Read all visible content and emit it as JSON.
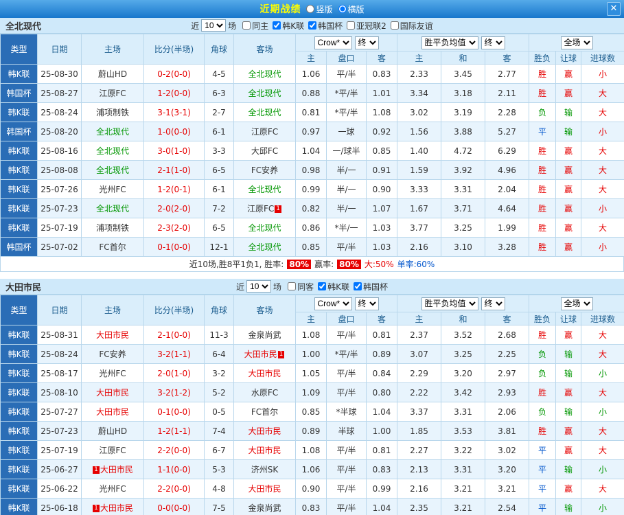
{
  "titlebar": {
    "title": "近期战绩",
    "layout_vertical": "竖版",
    "layout_horizontal": "横版",
    "close": "✕"
  },
  "table_header": {
    "type": "类型",
    "date": "日期",
    "home": "主场",
    "score": "比分(半场)",
    "corner": "角球",
    "away": "客场",
    "company": "Crow*",
    "final": "终",
    "europe": "胜平负均值",
    "fullmatch": "全场",
    "sub_asian_home": "主",
    "sub_handicap": "盘口",
    "sub_asian_away": "客",
    "sub_eu_home": "主",
    "sub_eu_draw": "和",
    "sub_eu_away": "客",
    "sub_wdl": "胜负",
    "sub_handicap_result": "让球",
    "sub_goals": "进球数"
  },
  "sections": [
    {
      "team": "全北现代",
      "filter": {
        "near": "近",
        "count": "10",
        "games": "场",
        "checkboxes": [
          {
            "label": "同主",
            "checked": false
          },
          {
            "label": "韩K联",
            "checked": true
          },
          {
            "label": "韩国杯",
            "checked": true
          },
          {
            "label": "亚冠联2",
            "checked": false
          },
          {
            "label": "国际友谊",
            "checked": false
          }
        ]
      },
      "rows": [
        {
          "type": "韩K联",
          "date": "25-08-30",
          "home": "蔚山HD",
          "score": "0-2(0-0)",
          "corner": "4-5",
          "away": "全北现代",
          "away_cls": "green",
          "ah": "1.06",
          "hc": "平/半",
          "aa": "0.83",
          "eh": "2.33",
          "ed": "3.45",
          "ea": "2.77",
          "r1": "胜",
          "r1c": "red",
          "r2": "赢",
          "r2c": "red",
          "r3": "小",
          "r3c": "red"
        },
        {
          "type": "韩国杯",
          "date": "25-08-27",
          "home": "江原FC",
          "score": "1-2(0-0)",
          "corner": "6-3",
          "away": "全北现代",
          "away_cls": "green",
          "ah": "0.88",
          "hc": "*平/半",
          "aa": "1.01",
          "eh": "3.34",
          "ed": "3.18",
          "ea": "2.11",
          "r1": "胜",
          "r1c": "red",
          "r2": "赢",
          "r2c": "red",
          "r3": "大",
          "r3c": "red"
        },
        {
          "type": "韩K联",
          "date": "25-08-24",
          "home": "浦项制铁",
          "score": "3-1(3-1)",
          "corner": "2-7",
          "away": "全北现代",
          "away_cls": "green",
          "ah": "0.81",
          "hc": "*平/半",
          "aa": "1.08",
          "eh": "3.02",
          "ed": "3.19",
          "ea": "2.28",
          "r1": "负",
          "r1c": "green",
          "r2": "输",
          "r2c": "green",
          "r3": "大",
          "r3c": "red"
        },
        {
          "type": "韩国杯",
          "date": "25-08-20",
          "home": "全北现代",
          "home_cls": "green",
          "score": "1-0(0-0)",
          "corner": "6-1",
          "away": "江原FC",
          "ah": "0.97",
          "hc": "一球",
          "aa": "0.92",
          "eh": "1.56",
          "ed": "3.88",
          "ea": "5.27",
          "r1": "平",
          "r1c": "blue",
          "r2": "输",
          "r2c": "green",
          "r3": "小",
          "r3c": "red"
        },
        {
          "type": "韩K联",
          "date": "25-08-16",
          "home": "全北现代",
          "home_cls": "green",
          "score": "3-0(1-0)",
          "corner": "3-3",
          "away": "大邱FC",
          "ah": "1.04",
          "hc": "一/球半",
          "aa": "0.85",
          "eh": "1.40",
          "ed": "4.72",
          "ea": "6.29",
          "r1": "胜",
          "r1c": "red",
          "r2": "赢",
          "r2c": "red",
          "r3": "大",
          "r3c": "red"
        },
        {
          "type": "韩K联",
          "date": "25-08-08",
          "home": "全北现代",
          "home_cls": "green",
          "score": "2-1(1-0)",
          "corner": "6-5",
          "away": "FC安养",
          "ah": "0.98",
          "hc": "半/一",
          "aa": "0.91",
          "eh": "1.59",
          "ed": "3.92",
          "ea": "4.96",
          "r1": "胜",
          "r1c": "red",
          "r2": "赢",
          "r2c": "red",
          "r3": "大",
          "r3c": "red"
        },
        {
          "type": "韩K联",
          "date": "25-07-26",
          "home": "光州FC",
          "score": "1-2(0-1)",
          "corner": "6-1",
          "away": "全北现代",
          "away_cls": "green",
          "ah": "0.99",
          "hc": "半/一",
          "aa": "0.90",
          "eh": "3.33",
          "ed": "3.31",
          "ea": "2.04",
          "r1": "胜",
          "r1c": "red",
          "r2": "赢",
          "r2c": "red",
          "r3": "大",
          "r3c": "red"
        },
        {
          "type": "韩K联",
          "date": "25-07-23",
          "home": "全北现代",
          "home_cls": "green",
          "score": "2-0(2-0)",
          "corner": "7-2",
          "away": "江原FC",
          "away_b_post": "1",
          "ah": "0.82",
          "hc": "半/一",
          "aa": "1.07",
          "eh": "1.67",
          "ed": "3.71",
          "ea": "4.64",
          "r1": "胜",
          "r1c": "red",
          "r2": "赢",
          "r2c": "red",
          "r3": "小",
          "r3c": "red"
        },
        {
          "type": "韩K联",
          "date": "25-07-19",
          "home": "浦项制铁",
          "score": "2-3(2-0)",
          "corner": "6-5",
          "away": "全北现代",
          "away_cls": "green",
          "ah": "0.86",
          "hc": "*半/一",
          "aa": "1.03",
          "eh": "3.77",
          "ed": "3.25",
          "ea": "1.99",
          "r1": "胜",
          "r1c": "red",
          "r2": "赢",
          "r2c": "red",
          "r3": "大",
          "r3c": "red"
        },
        {
          "type": "韩国杯",
          "date": "25-07-02",
          "home": "FC首尔",
          "score": "0-1(0-0)",
          "corner": "12-1",
          "away": "全北现代",
          "away_cls": "green",
          "ah": "0.85",
          "hc": "平/半",
          "aa": "1.03",
          "eh": "2.16",
          "ed": "3.10",
          "ea": "3.28",
          "r1": "胜",
          "r1c": "red",
          "r2": "赢",
          "r2c": "red",
          "r3": "小",
          "r3c": "red"
        }
      ],
      "summary_parts": [
        {
          "text": "近10场,胜8平1负1, 胜率:",
          "cls": ""
        },
        {
          "text": "80%",
          "cls": "badge"
        },
        {
          "text": "赢率:",
          "cls": ""
        },
        {
          "text": "80%",
          "cls": "badge"
        },
        {
          "text": "大:50%",
          "cls": "red"
        },
        {
          "text": "单率:60%",
          "cls": "blue"
        }
      ]
    },
    {
      "team": "大田市民",
      "filter": {
        "near": "近",
        "count": "10",
        "games": "场",
        "checkboxes": [
          {
            "label": "同客",
            "checked": false
          },
          {
            "label": "韩K联",
            "checked": true
          },
          {
            "label": "韩国杯",
            "checked": true
          }
        ]
      },
      "rows": [
        {
          "type": "韩K联",
          "date": "25-08-31",
          "home": "大田市民",
          "home_cls": "red",
          "score": "2-1(0-0)",
          "corner": "11-3",
          "away": "金泉尚武",
          "ah": "1.08",
          "hc": "平/半",
          "aa": "0.81",
          "eh": "2.37",
          "ed": "3.52",
          "ea": "2.68",
          "r1": "胜",
          "r1c": "red",
          "r2": "赢",
          "r2c": "red",
          "r3": "大",
          "r3c": "red"
        },
        {
          "type": "韩K联",
          "date": "25-08-24",
          "home": "FC安养",
          "score": "3-2(1-1)",
          "corner": "6-4",
          "away": "大田市民",
          "away_cls": "red",
          "away_b_post": "1",
          "ah": "1.00",
          "hc": "*平/半",
          "aa": "0.89",
          "eh": "3.07",
          "ed": "3.25",
          "ea": "2.25",
          "r1": "负",
          "r1c": "green",
          "r2": "输",
          "r2c": "green",
          "r3": "大",
          "r3c": "red"
        },
        {
          "type": "韩K联",
          "date": "25-08-17",
          "home": "光州FC",
          "score": "2-0(1-0)",
          "corner": "3-2",
          "away": "大田市民",
          "away_cls": "red",
          "ah": "1.05",
          "hc": "平/半",
          "aa": "0.84",
          "eh": "2.29",
          "ed": "3.20",
          "ea": "2.97",
          "r1": "负",
          "r1c": "green",
          "r2": "输",
          "r2c": "green",
          "r3": "小",
          "r3c": "green"
        },
        {
          "type": "韩K联",
          "date": "25-08-10",
          "home": "大田市民",
          "home_cls": "red",
          "score": "3-2(1-2)",
          "corner": "5-2",
          "away": "水原FC",
          "ah": "1.09",
          "hc": "平/半",
          "aa": "0.80",
          "eh": "2.22",
          "ed": "3.42",
          "ea": "2.93",
          "r1": "胜",
          "r1c": "red",
          "r2": "赢",
          "r2c": "red",
          "r3": "大",
          "r3c": "red"
        },
        {
          "type": "韩K联",
          "date": "25-07-27",
          "home": "大田市民",
          "home_cls": "red",
          "score": "0-1(0-0)",
          "corner": "0-5",
          "away": "FC首尔",
          "ah": "0.85",
          "hc": "*半球",
          "aa": "1.04",
          "eh": "3.37",
          "ed": "3.31",
          "ea": "2.06",
          "r1": "负",
          "r1c": "green",
          "r2": "输",
          "r2c": "green",
          "r3": "小",
          "r3c": "green"
        },
        {
          "type": "韩K联",
          "date": "25-07-23",
          "home": "蔚山HD",
          "score": "1-2(1-1)",
          "corner": "7-4",
          "away": "大田市民",
          "away_cls": "red",
          "ah": "0.89",
          "hc": "半球",
          "aa": "1.00",
          "eh": "1.85",
          "ed": "3.53",
          "ea": "3.81",
          "r1": "胜",
          "r1c": "red",
          "r2": "赢",
          "r2c": "red",
          "r3": "大",
          "r3c": "red"
        },
        {
          "type": "韩K联",
          "date": "25-07-19",
          "home": "江原FC",
          "score": "2-2(0-0)",
          "corner": "6-7",
          "away": "大田市民",
          "away_cls": "red",
          "ah": "1.08",
          "hc": "平/半",
          "aa": "0.81",
          "eh": "2.27",
          "ed": "3.22",
          "ea": "3.02",
          "r1": "平",
          "r1c": "blue",
          "r2": "赢",
          "r2c": "red",
          "r3": "大",
          "r3c": "red"
        },
        {
          "type": "韩K联",
          "date": "25-06-27",
          "home": "大田市民",
          "home_cls": "red",
          "home_b_pre": "1",
          "score": "1-1(0-0)",
          "corner": "5-3",
          "away": "济州SK",
          "ah": "1.06",
          "hc": "平/半",
          "aa": "0.83",
          "eh": "2.13",
          "ed": "3.31",
          "ea": "3.20",
          "r1": "平",
          "r1c": "blue",
          "r2": "输",
          "r2c": "green",
          "r3": "小",
          "r3c": "green"
        },
        {
          "type": "韩K联",
          "date": "25-06-22",
          "home": "光州FC",
          "score": "2-2(0-0)",
          "corner": "4-8",
          "away": "大田市民",
          "away_cls": "red",
          "ah": "0.90",
          "hc": "平/半",
          "aa": "0.99",
          "eh": "2.16",
          "ed": "3.21",
          "ea": "3.21",
          "r1": "平",
          "r1c": "blue",
          "r2": "赢",
          "r2c": "red",
          "r3": "大",
          "r3c": "red"
        },
        {
          "type": "韩K联",
          "date": "25-06-18",
          "home": "大田市民",
          "home_cls": "red",
          "home_b_pre": "1",
          "score": "0-0(0-0)",
          "corner": "7-5",
          "away": "金泉尚武",
          "ah": "0.83",
          "hc": "平/半",
          "aa": "1.04",
          "eh": "2.35",
          "ed": "3.21",
          "ea": "2.54",
          "r1": "平",
          "r1c": "blue",
          "r2": "输",
          "r2c": "green",
          "r3": "小",
          "r3c": "green"
        }
      ]
    }
  ]
}
